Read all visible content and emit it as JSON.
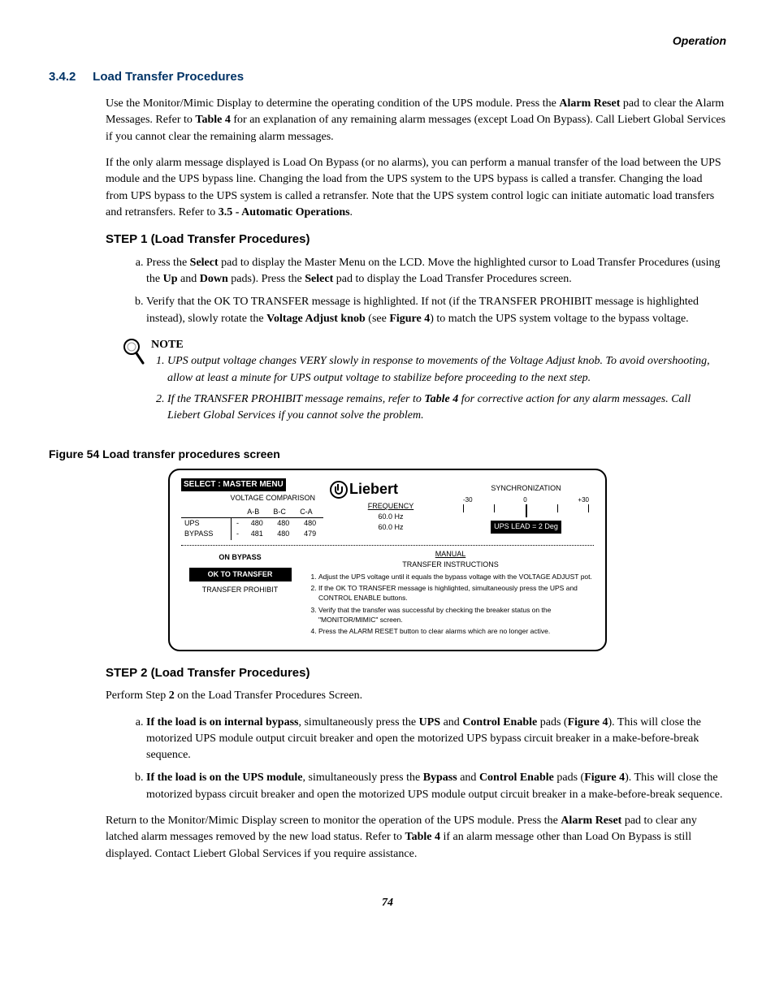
{
  "header": {
    "section": "Operation"
  },
  "section": {
    "number": "3.4.2",
    "title": "Load Transfer Procedures"
  },
  "para1": "Use the Monitor/Mimic Display to determine the operating condition of the UPS module. Press the ",
  "para1b": "Alarm Reset",
  "para1c": " pad to clear the Alarm Messages. Refer to ",
  "para1d": "Table 4",
  "para1e": " for an explanation of any remaining alarm messages (except Load On Bypass). Call Liebert Global Services if you cannot clear the remaining alarm messages.",
  "para2a": "If the only alarm message displayed is Load On Bypass (or no alarms), you can perform a manual transfer of the load between the UPS module and the UPS bypass line. Changing the load from the UPS system to the UPS bypass is called a transfer. Changing the load from UPS bypass to the UPS system is called a retransfer. Note that the UPS system control logic can initiate automatic load transfers and retransfers. Refer to ",
  "para2b": "3.5 - Automatic Operations",
  "para2c": ".",
  "step1": {
    "heading": "STEP 1 (Load Transfer Procedures)"
  },
  "s1a_1": "Press the ",
  "s1a_2": "Select",
  "s1a_3": " pad to display the Master Menu on the LCD. Move the highlighted cursor to Load Transfer Procedures (using the ",
  "s1a_4": "Up",
  "s1a_5": " and ",
  "s1a_6": "Down",
  "s1a_7": " pads). Press the ",
  "s1a_8": "Select",
  "s1a_9": " pad to display the Load Transfer Procedures screen.",
  "s1b_1": "Verify that the OK TO TRANSFER message is highlighted. If not (if the TRANSFER PROHIBIT message is highlighted instead), slowly rotate the ",
  "s1b_2": "Voltage Adjust knob",
  "s1b_3": " (see ",
  "s1b_4": "Figure 4",
  "s1b_5": ") to match the UPS system voltage to the bypass voltage.",
  "note": {
    "label": "NOTE",
    "n1a": "UPS output voltage changes VERY slowly in response to movements of the Voltage Adjust knob. To avoid overshooting, allow at least a minute for UPS output voltage to stabilize before proceeding to the next step.",
    "n2a": "If the TRANSFER PROHIBIT message remains, refer to ",
    "n2b": "Table 4",
    "n2c": " for corrective action for any alarm messages. Call Liebert Global Services if you cannot solve the problem."
  },
  "figure": {
    "caption": "Figure 54  Load transfer procedures screen"
  },
  "screen": {
    "title": "SELECT  :  MASTER MENU",
    "voltcomp_label": "VOLTAGE COMPARISON",
    "volt_headers": [
      "",
      "A-B",
      "B-C",
      "C-A"
    ],
    "volt_rows": [
      {
        "label": "UPS",
        "dash": "-",
        "ab": "480",
        "bc": "480",
        "ca": "480"
      },
      {
        "label": "BYPASS",
        "dash": "-",
        "ab": "481",
        "bc": "480",
        "ca": "479"
      }
    ],
    "logo": "Liebert",
    "freq_label": "FREQUENCY",
    "freq1": "60.0 Hz",
    "freq2": "60.0 Hz",
    "sync_label": "SYNCHRONIZATION",
    "gauge": {
      "left": "-30",
      "mid": "0",
      "right": "+30"
    },
    "lead": "UPS  LEAD    =    2 Deg",
    "status": {
      "on_bypass": "ON BYPASS",
      "ok": "OK  TO  TRANSFER",
      "prohibit": "TRANSFER PROHIBIT"
    },
    "instr_head1": "MANUAL",
    "instr_head2": "TRANSFER INSTRUCTIONS",
    "instructions": [
      "Adjust the UPS voltage until it equals the bypass voltage with the VOLTAGE ADJUST pot.",
      "If the OK TO TRANSFER message is highlighted, simultaneously press the UPS and CONTROL ENABLE buttons.",
      "Verify that the transfer was successful by checking the breaker status on the \"MONITOR/MIMIC\" screen.",
      "Press the ALARM RESET button to clear alarms which are no longer active."
    ]
  },
  "step2": {
    "heading": "STEP 2 (Load Transfer Procedures)"
  },
  "s2_intro1": "Perform Step ",
  "s2_intro2": "2",
  "s2_intro3": " on the Load Transfer Procedures Screen.",
  "s2a_1": "If the load is on internal bypass",
  "s2a_2": ", simultaneously press the ",
  "s2a_3": "UPS",
  "s2a_4": " and ",
  "s2a_5": "Control Enable",
  "s2a_6": " pads (",
  "s2a_7": "Figure 4",
  "s2a_8": "). This will close the motorized UPS module output circuit breaker and open the motorized UPS bypass circuit breaker in a make-before-break sequence.",
  "s2b_1": "If the load is on the UPS module",
  "s2b_2": ", simultaneously press the ",
  "s2b_3": "Bypass",
  "s2b_4": " and ",
  "s2b_5": "Control Enable",
  "s2b_6": " pads (",
  "s2b_7": "Figure 4",
  "s2b_8": "). This will close the motorized bypass circuit breaker and open the motorized UPS module output circuit breaker in a make-before-break sequence.",
  "para_last1": "Return to the Monitor/Mimic Display screen to monitor the operation of the UPS module. Press the ",
  "para_last2": "Alarm Reset",
  "para_last3": " pad to clear any latched alarm messages removed by the new load status. Refer to ",
  "para_last4": "Table 4",
  "para_last5": " if an alarm message other than Load On Bypass is still displayed. Contact Liebert Global Services if you require assistance.",
  "page": "74"
}
